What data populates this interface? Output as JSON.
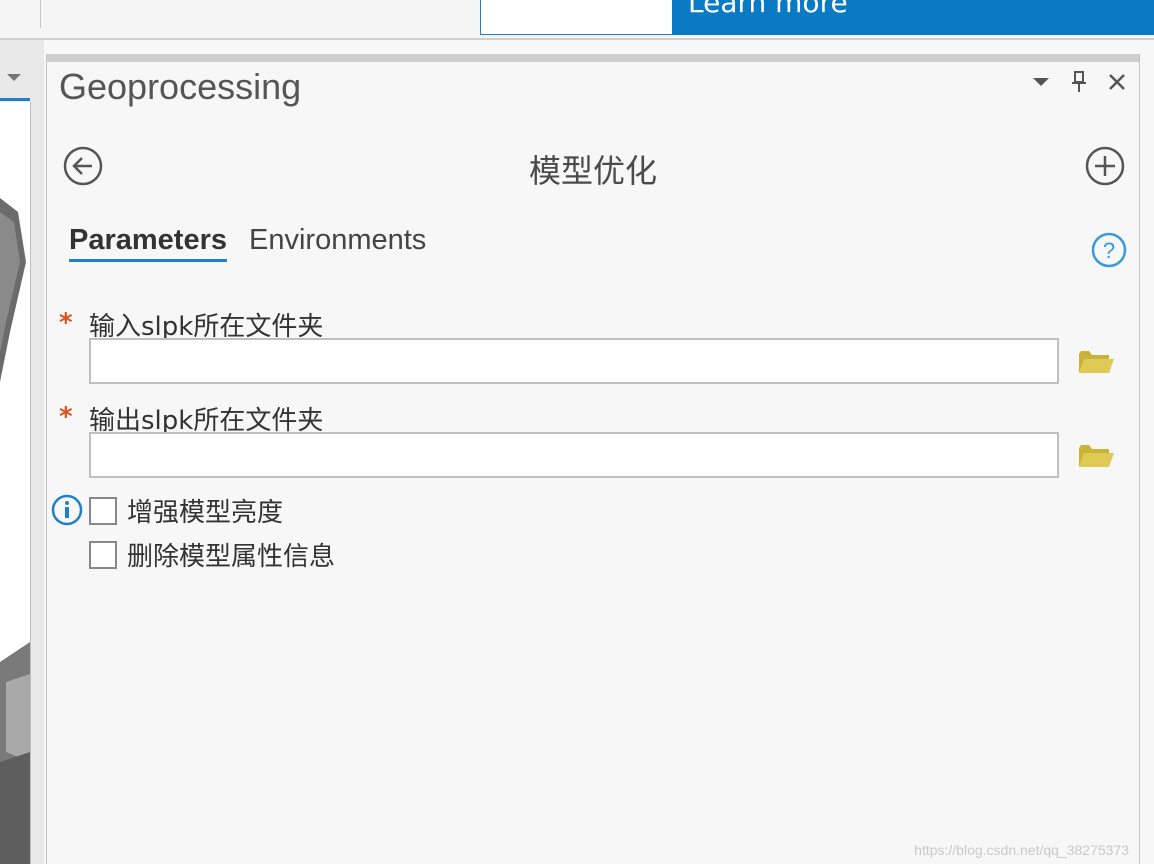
{
  "banner": {
    "learn_more": "Learn more",
    "brand_color": "#0a7ac4"
  },
  "pane": {
    "title": "Geoprocessing",
    "controls": [
      "dropdown-icon",
      "pin-icon",
      "close-icon"
    ]
  },
  "tool": {
    "title": "模型优化"
  },
  "tabs": [
    {
      "label": "Parameters",
      "active": true
    },
    {
      "label": "Environments",
      "active": false
    }
  ],
  "parameters": [
    {
      "label": "输入slpk所在文件夹",
      "required": true,
      "value": ""
    },
    {
      "label": "输出slpk所在文件夹",
      "required": true,
      "value": ""
    }
  ],
  "required_mark": "*",
  "checkboxes": [
    {
      "label": "增强模型亮度",
      "checked": false,
      "info": true
    },
    {
      "label": "删除模型属性信息",
      "checked": false,
      "info": false
    }
  ],
  "watermark": "https://blog.csdn.net/qq_38275373",
  "colors": {
    "accent": "#1f7fc8",
    "required": "#d9541e",
    "folder": "#d8c24a"
  }
}
